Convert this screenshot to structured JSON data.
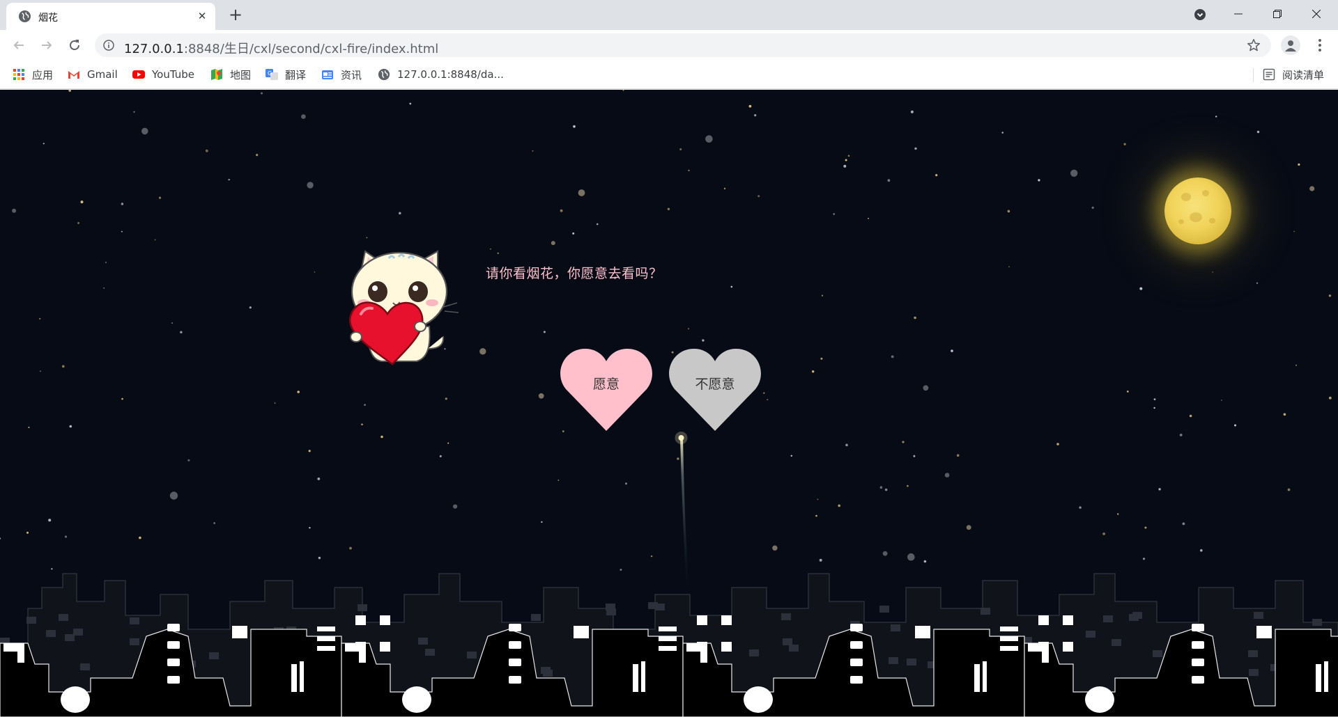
{
  "browser": {
    "tab_title": "烟花",
    "url_host": "127.0.0.1",
    "url_port": ":8848",
    "url_path": "/生日/cxl/second/cxl-fire/index.html",
    "bookmarks": [
      {
        "label": "应用",
        "icon": "apps-grid-icon"
      },
      {
        "label": "Gmail",
        "icon": "gmail-icon"
      },
      {
        "label": "YouTube",
        "icon": "youtube-icon"
      },
      {
        "label": "地图",
        "icon": "maps-icon"
      },
      {
        "label": "翻译",
        "icon": "translate-icon"
      },
      {
        "label": "资讯",
        "icon": "news-icon"
      },
      {
        "label": "127.0.0.1:8848/da...",
        "icon": "globe-icon"
      }
    ],
    "reading_list": "阅读清单"
  },
  "page": {
    "question": "请你看烟花，你愿意去看吗？",
    "yes_label": "愿意",
    "no_label": "不愿意",
    "colors": {
      "background": "#070b16",
      "question_text": "#ffc0cb",
      "yes_heart": "#ffc0cb",
      "no_heart": "#c8c8c8",
      "moon": "#f1d35a"
    }
  }
}
